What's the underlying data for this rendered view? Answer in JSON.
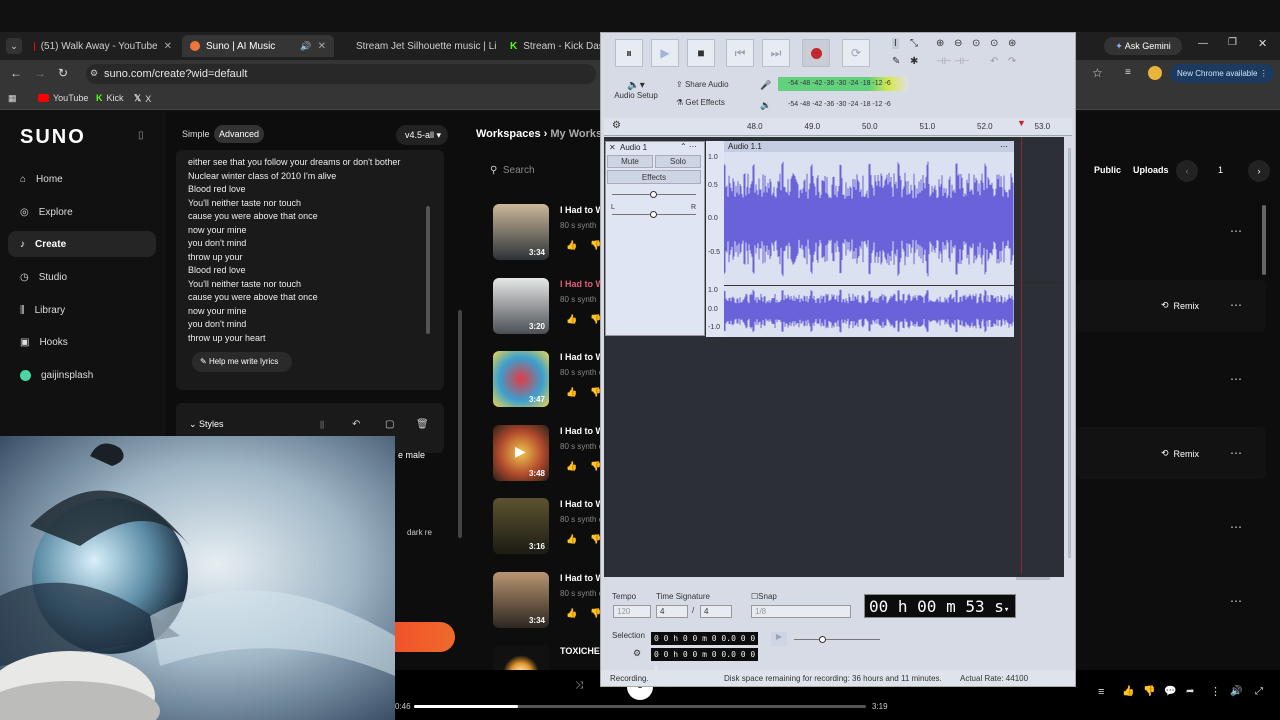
{
  "browser": {
    "tabs": [
      {
        "title": "(51) Walk Away - YouTube",
        "color": "#ff0000"
      },
      {
        "title": "Suno | AI Music",
        "color": "#f0763b"
      },
      {
        "title": "Stream Jet Silhouette music | Li",
        "color": "#ff5500"
      },
      {
        "title": "Stream - Kick Dashbo",
        "color": "#53fc18"
      }
    ],
    "url": "suno.com/create?wid=default",
    "bookmarks": [
      "YouTube",
      "Kick",
      "X"
    ],
    "ask_gemini": "Ask Gemini",
    "new_chrome": "New Chrome available"
  },
  "suno": {
    "logo": "SUNO",
    "nav": [
      "Home",
      "Explore",
      "Create",
      "Studio",
      "Library",
      "Hooks",
      "gaijinsplash"
    ],
    "mode_simple": "Simple",
    "mode_advanced": "Advanced",
    "model": "v4.5-all",
    "workspace_crumb": "Workspaces",
    "workspace_name": "My Worksp",
    "search_placeholder": "Search",
    "lyrics": [
      "either see that you follow your dreams or don't bother",
      "Nuclear winter class of 2010 I'm alive",
      "Blood red love",
      "You'll neither taste nor touch",
      "cause you were above that once",
      "now your mine",
      "you don't mind",
      "throw up your",
      "Blood red love",
      "You'll neither taste nor touch",
      "cause you were above that once",
      "now your mine",
      "you don't mind",
      "throw up your heart"
    ],
    "help_lyrics": "Help me write lyrics",
    "styles_label": "Styles",
    "style_snip1": "e male",
    "style_snip2": "dark re",
    "public": "Public",
    "uploads": "Uploads",
    "page": "1",
    "remix": "Remix",
    "songs": [
      {
        "title": "I Had to W",
        "sub": "80 s synth",
        "dur": "3:34"
      },
      {
        "title": "I Had to W",
        "sub": "80 s synth",
        "dur": "3:20"
      },
      {
        "title": "I Had to W",
        "sub": "80 s synth e",
        "dur": "3:47"
      },
      {
        "title": "I Had to W",
        "sub": "80 s synth e",
        "dur": "3:48"
      },
      {
        "title": "I Had to W",
        "sub": "80 s synth e",
        "dur": "3:16"
      },
      {
        "title": "I Had to W",
        "sub": "80 s synth e",
        "dur": "3:34"
      },
      {
        "title": "TOXICHE",
        "sub": "",
        "dur": ""
      }
    ],
    "player_current": "0:46",
    "player_total": "3:19",
    "player_progress": 0.23
  },
  "audacity": {
    "audio_setup": "Audio Setup",
    "share_audio": "Share Audio",
    "get_effects": "Get Effects",
    "meter_ticks": "-54 -48 -42 -36 -30 -24 -18 -12 -6",
    "ruler": [
      "48.0",
      "49.0",
      "50.0",
      "51.0",
      "52.0",
      "53.0"
    ],
    "track_name": "Audio 1",
    "clip_name": "Audio 1.1",
    "mute": "Mute",
    "solo": "Solo",
    "effects": "Effects",
    "scale_upper": [
      "1.0",
      "0.5",
      "0.0",
      "-0.5"
    ],
    "scale_lower": [
      "1.0",
      "0.0",
      "-1.0"
    ],
    "tempo_label": "Tempo",
    "tempo_value": "120",
    "time_sig_label": "Time Signature",
    "time_sig_num": "4",
    "time_sig_den": "4",
    "snap_label": "Snap",
    "snap_value": "1/8",
    "time_display": "00 h 00 m 53 s",
    "selection_label": "Selection",
    "sel_start": "0 0 h 0 0 m 0 0.0 0 0 s",
    "sel_end": "0 0 h 0 0 m 0 0.0 0 0 s",
    "status_left": "Recording.",
    "status_mid": "Disk space remaining for recording: 36 hours and 11 minutes.",
    "status_right": "Actual Rate: 44100"
  }
}
